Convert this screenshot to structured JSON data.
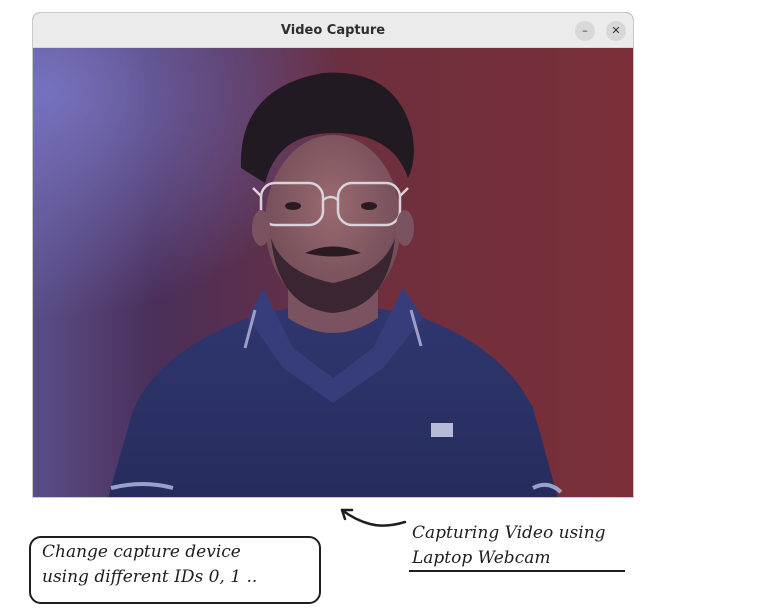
{
  "window": {
    "title": "Video Capture",
    "minimize_glyph": "–",
    "close_glyph": "✕"
  },
  "icons": [
    "minimize-icon",
    "close-icon",
    "arrow-icon"
  ],
  "annotations": {
    "left_line1": "Change capture device",
    "left_line2": "using different IDs 0, 1 ..",
    "right_line1": "Capturing Video using",
    "right_line2": "Laptop Webcam"
  }
}
